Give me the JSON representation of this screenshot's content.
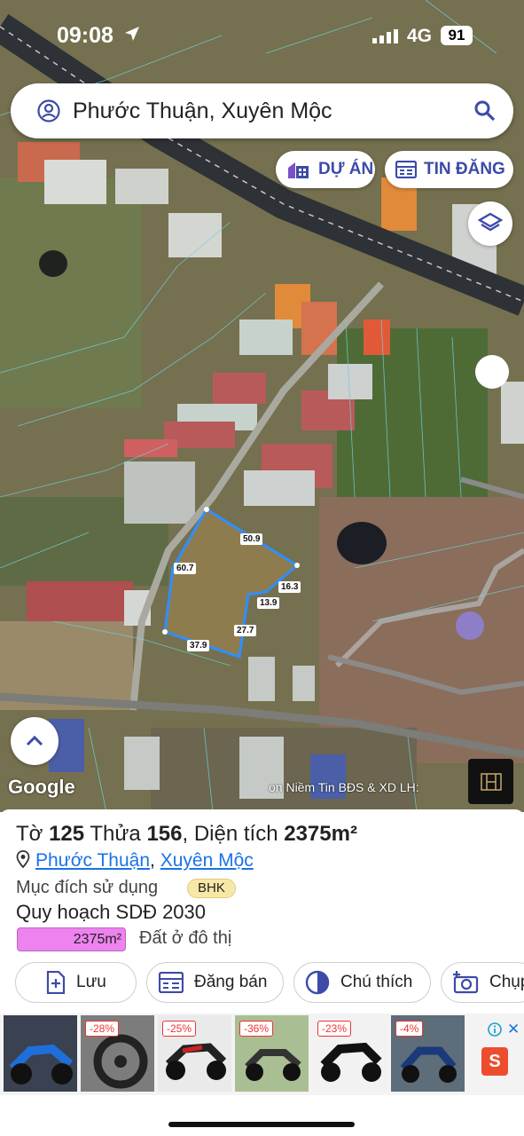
{
  "status_bar": {
    "time": "09:08",
    "network": "4G",
    "battery": "91"
  },
  "search": {
    "query": "Phước Thuận, Xuyên Mộc"
  },
  "chips": {
    "du_an": "DỰ ÁN",
    "tin_dang": "TIN ĐĂNG"
  },
  "map": {
    "attribution": "Google",
    "watermark": "on Niềm Tin BĐS & XD LH:",
    "plot_edges": [
      "50.9",
      "60.7",
      "16.3",
      "13.9",
      "27.7",
      "37.9"
    ]
  },
  "parcel": {
    "to_label": "Tờ",
    "to_value": "125",
    "thua_label": "Thửa",
    "thua_value": "156",
    "area_label": "Diện tích",
    "area_value": "2375m²",
    "ward": "Phước Thuận",
    "separator": ",",
    "district": "Xuyên Mộc",
    "purpose_label": "Mục đích sử dụng",
    "purpose_code": "BHK",
    "plan_title": "Quy hoạch SDĐ 2030",
    "plan_area": "2375m²",
    "plan_desc": "Đất ở đô thị",
    "plan_color": "#ee82ee"
  },
  "actions": [
    {
      "label": "Lưu",
      "icon": "bookmark-plus-icon"
    },
    {
      "label": "Đăng bán",
      "icon": "listing-icon"
    },
    {
      "label": "Chú thích",
      "icon": "contrast-icon"
    },
    {
      "label": "Chụp",
      "icon": "camera-plus-icon"
    }
  ],
  "ads": {
    "discounts": [
      "-28%",
      "-25%",
      "-36%",
      "-23%",
      "-4%"
    ]
  },
  "colors": {
    "accent": "#3c4ba8",
    "link": "#1a73e8",
    "plot_outline": "#2f8fff"
  }
}
